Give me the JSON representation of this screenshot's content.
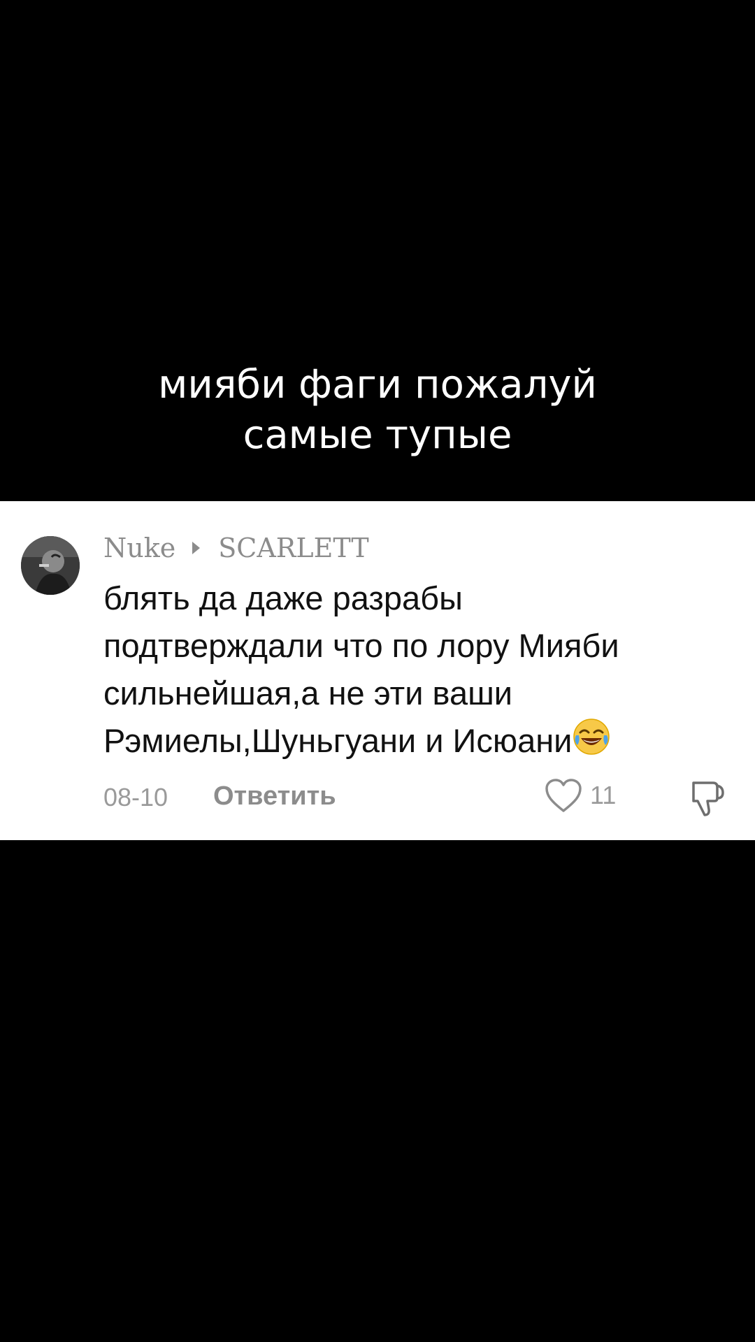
{
  "video_caption": {
    "line1": "мияби фаги пожалуй",
    "line2": "самые тупые"
  },
  "comment": {
    "author": "Nuke",
    "reply_to": "SCARLETT",
    "text_lines": [
      "блять да даже разрабы",
      "подтверждали что по лору Мияби",
      "сильнейшая,а не эти ваши",
      "Рэмиелы,Шуньгуани и Исюани"
    ],
    "emoji": "face-with-tears-of-joy",
    "date": "08-10",
    "reply_label": "Ответить",
    "like_count": "11",
    "like_icon": "heart-outline-icon",
    "dislike_icon": "thumbs-down-icon"
  },
  "colors": {
    "background": "#000000",
    "card": "#ffffff",
    "muted_text": "#8c8c8c",
    "body_text": "#111111"
  }
}
